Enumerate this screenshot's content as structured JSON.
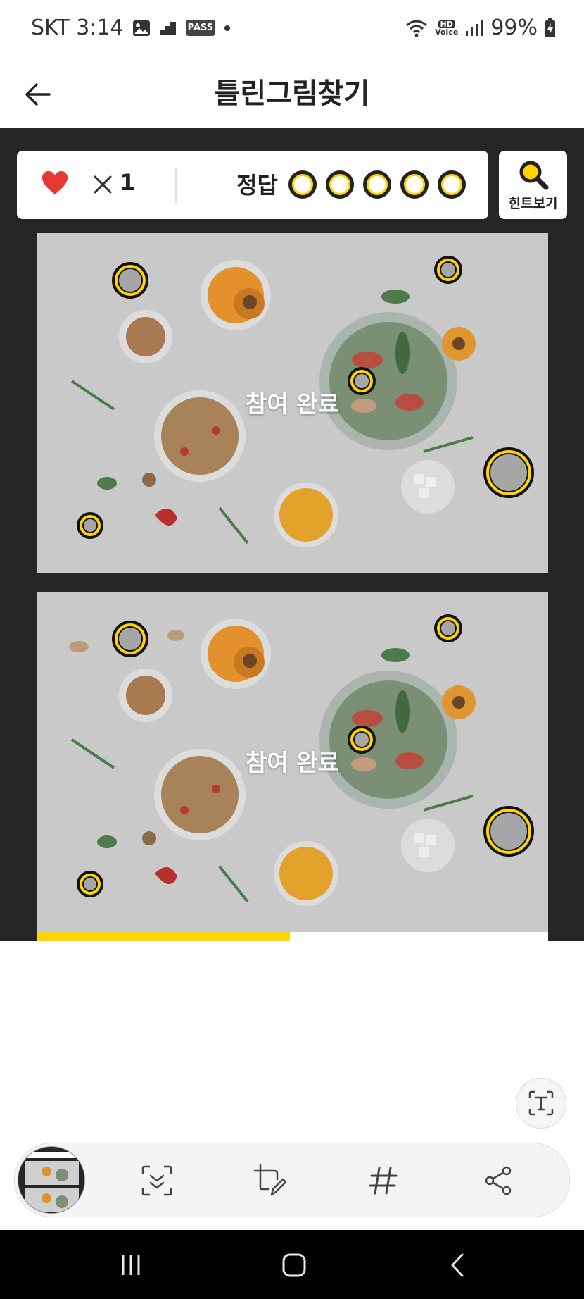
{
  "status_bar": {
    "carrier_time": "SKT 3:14",
    "pass_badge": "PASS",
    "hd_label": "HD",
    "voice_label": "Voice",
    "battery": "99%",
    "icons": [
      "image-icon",
      "stairs-icon",
      "pass-icon",
      "dot-icon",
      "wifi-icon",
      "hd-voice-icon",
      "signal-icon",
      "battery-charging-icon"
    ]
  },
  "header": {
    "title": "틀린그림찾기",
    "back_icon": "arrow-left-icon"
  },
  "score": {
    "lives_icon": "heart-icon",
    "times_symbol": "×",
    "lives_count": "1",
    "answer_label": "정답",
    "answer_slots_total": 5,
    "answer_slots_found": 0
  },
  "hint": {
    "label": "힌트보기",
    "icon": "magnifier-icon"
  },
  "puzzles": {
    "top_overlay": "참여 완료",
    "bottom_overlay": "참여 완료"
  },
  "progress": {
    "fraction": 0.495
  },
  "colors": {
    "accent": "#ffd400",
    "heart": "#e53935",
    "dark_bg": "#262626"
  },
  "toolbar": {
    "icons": [
      "thumbnail",
      "scan-capture-icon",
      "crop-edit-icon",
      "hashtag-icon",
      "share-icon"
    ]
  },
  "floating": {
    "icon": "text-extract-icon"
  },
  "nav": {
    "icons": [
      "recent-apps-icon",
      "home-icon",
      "back-icon"
    ]
  }
}
